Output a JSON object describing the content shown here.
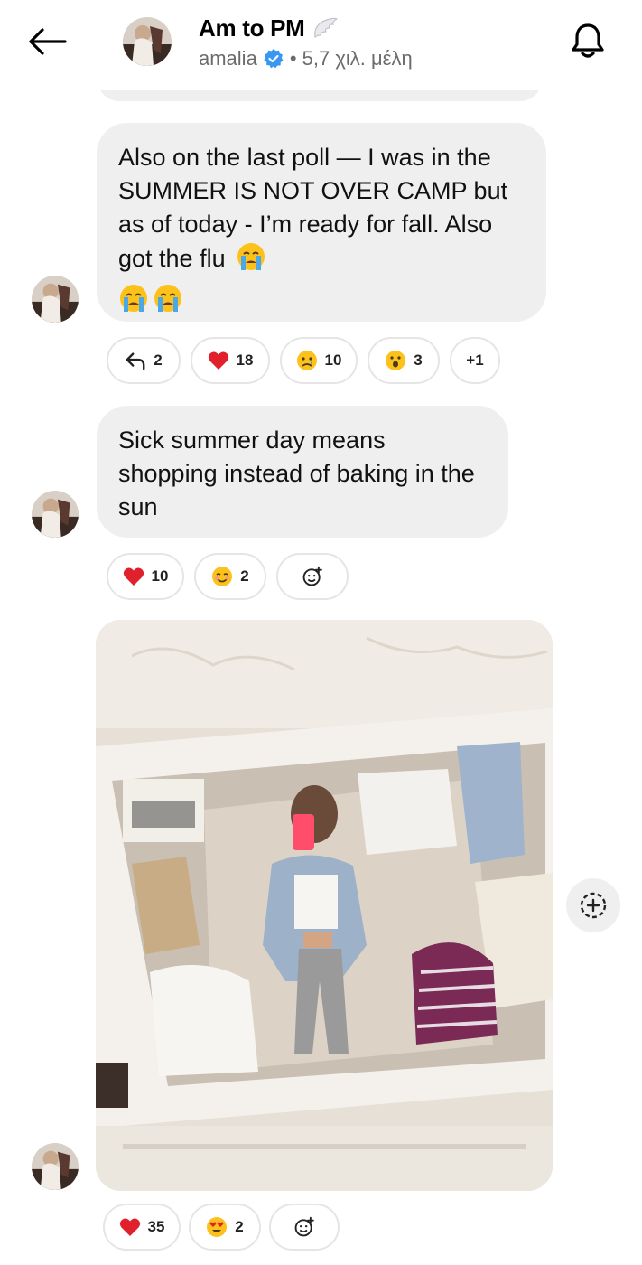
{
  "header": {
    "title": "Am to PM",
    "title_icon": "angel-wing-icon",
    "username": "amalia",
    "members": "• 5,7 χιλ. μέλη"
  },
  "messages": [
    {
      "text": "Also on the last poll — I was in the SUMMER IS NOT OVER CAMP but as of today - I’m ready for fall. Also got the flu",
      "emojis": "😭 😭 😭",
      "reactions": [
        {
          "icon": "reply-arrow-icon",
          "count": "2"
        },
        {
          "icon": "red-heart-emoji",
          "count": "18"
        },
        {
          "icon": "sad-face-emoji",
          "count": "10"
        },
        {
          "icon": "surprised-face-emoji",
          "count": "3"
        },
        {
          "icon": "",
          "count": "+1"
        }
      ]
    },
    {
      "text": "Sick summer day means shopping instead of baking in the sun",
      "reactions": [
        {
          "icon": "red-heart-emoji",
          "count": "10"
        },
        {
          "icon": "smiling-blush-emoji",
          "count": "2"
        },
        {
          "icon": "add-reaction-icon",
          "count": ""
        }
      ]
    },
    {
      "type": "image",
      "description_icon": "mirror-selfie-photo",
      "reactions": [
        {
          "icon": "red-heart-emoji",
          "count": "35"
        },
        {
          "icon": "heart-eyes-emoji",
          "count": "2"
        },
        {
          "icon": "add-reaction-icon",
          "count": ""
        }
      ]
    }
  ],
  "colors": {
    "bubble": "#efefef",
    "verified": "#3897f0",
    "heart": "#e0202b",
    "emoji_yellow": "#fcc21b"
  }
}
